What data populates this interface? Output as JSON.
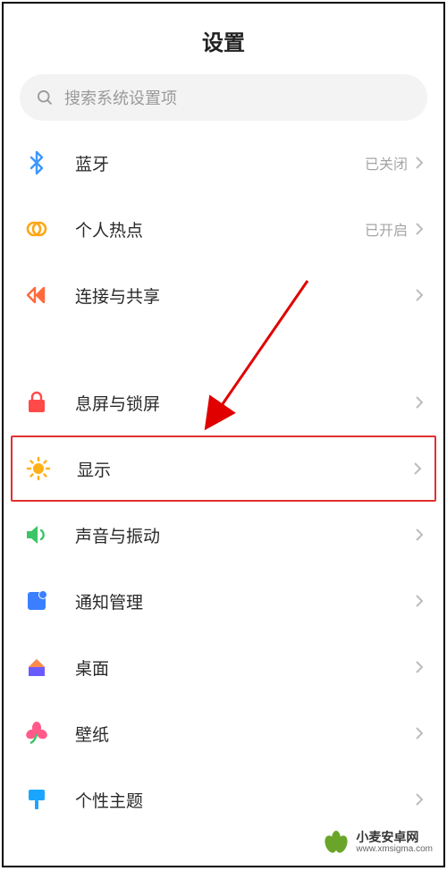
{
  "header": {
    "title": "设置"
  },
  "search": {
    "placeholder": "搜索系统设置项"
  },
  "rows": {
    "bluetooth": {
      "label": "蓝牙",
      "status": "已关闭"
    },
    "hotspot": {
      "label": "个人热点",
      "status": "已开启"
    },
    "share": {
      "label": "连接与共享"
    },
    "lockscreen": {
      "label": "息屏与锁屏"
    },
    "display": {
      "label": "显示"
    },
    "sound": {
      "label": "声音与振动"
    },
    "notif": {
      "label": "通知管理"
    },
    "home": {
      "label": "桌面"
    },
    "wallpaper": {
      "label": "壁纸"
    },
    "theme": {
      "label": "个性主题"
    }
  },
  "watermark": {
    "title": "小麦安卓网",
    "url": "www.xmsigma.com"
  }
}
